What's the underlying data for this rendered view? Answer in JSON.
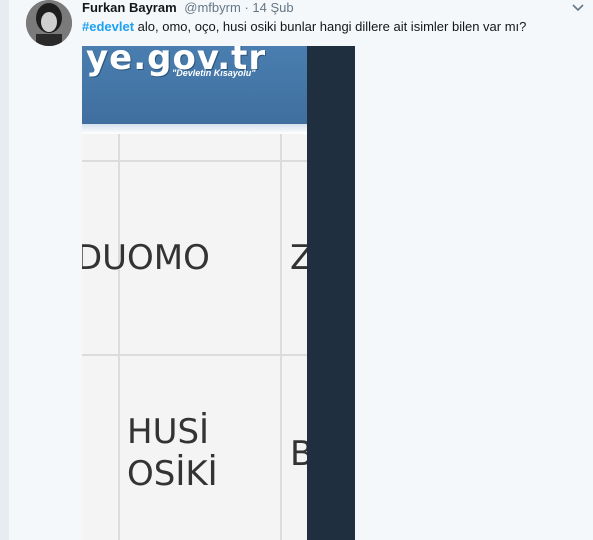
{
  "tweet": {
    "display_name": "Furkan Bayram",
    "handle": "@mfbyrm",
    "separator": "·",
    "timestamp": "14 Şub",
    "hashtag": "#edevlet",
    "text": " alo, omo, oço, husi osiki bunlar hangi dillere ait isimler bilen var mı?"
  },
  "media": {
    "banner_domain": "ye.gov.tr",
    "banner_slogan": "\"Devletin Kısayolu\"",
    "row1_left": "DU",
    "row1_mid": "OMO",
    "row1_right": "Z",
    "row2_mid_line1": "HUSİ",
    "row2_mid_line2": "OSİKİ",
    "row2_right": "B"
  },
  "icons": {
    "caret": "chevron-down-icon",
    "avatar": "avatar"
  },
  "colors": {
    "hashtag": "#1da1f2",
    "banner": "#4a7eb0",
    "dark_panel": "#1f2f3f",
    "background": "#f5f8fa"
  }
}
